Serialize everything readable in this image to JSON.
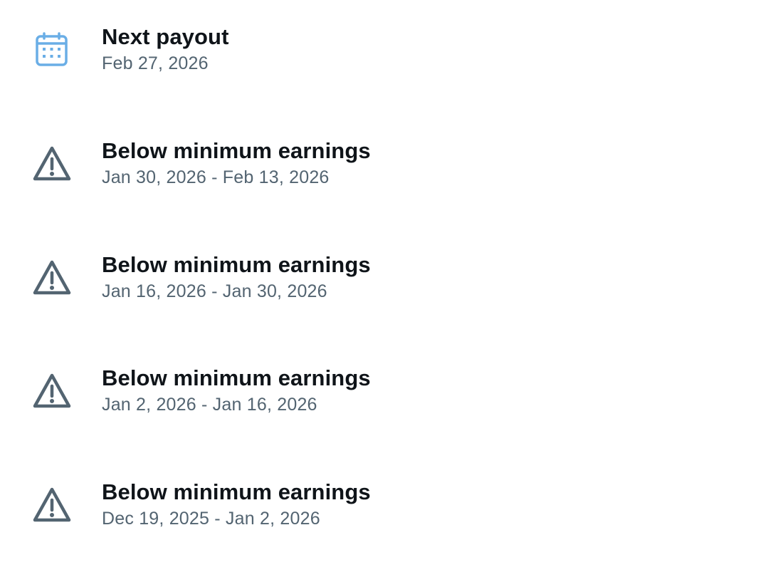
{
  "payout": {
    "icon": "calendar-icon",
    "title": "Next payout",
    "date": "Feb 27, 2026",
    "icon_color": "#1d9bf0"
  },
  "periods": [
    {
      "icon": "warning-icon",
      "title": "Below minimum earnings",
      "range": "Jan 30, 2026 - Feb 13, 2026"
    },
    {
      "icon": "warning-icon",
      "title": "Below minimum earnings",
      "range": "Jan 16, 2026 - Jan 30, 2026"
    },
    {
      "icon": "warning-icon",
      "title": "Below minimum earnings",
      "range": "Jan 2, 2026 - Jan 16, 2026"
    },
    {
      "icon": "warning-icon",
      "title": "Below minimum earnings",
      "range": "Dec 19, 2025 - Jan 2, 2026"
    }
  ],
  "colors": {
    "title": "#0f1419",
    "subtitle": "#536471",
    "warning_icon": "#536471"
  }
}
